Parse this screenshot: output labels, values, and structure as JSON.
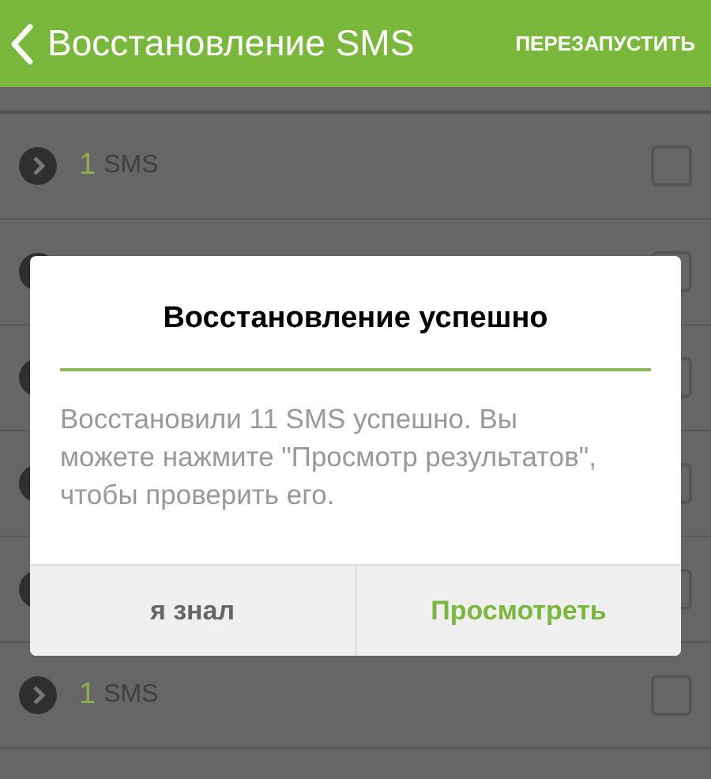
{
  "header": {
    "title": "Восстановление SMS",
    "action": "ПЕРЕЗАПУСТИТЬ"
  },
  "rows": [
    {
      "count": "1",
      "unit": "SMS",
      "checked": false
    },
    {
      "checked": false
    },
    {
      "checked": false
    },
    {
      "checked": false
    },
    {
      "checked": false
    },
    {
      "count": "1",
      "unit": "SMS",
      "checked": false
    }
  ],
  "dialog": {
    "title": "Восстановление успешно",
    "message": "Восстановили 11 SMS успешно. Вы можете нажмите \"Просмотр результатов\", чтобы проверить его.",
    "buttons": [
      {
        "label": "я знал",
        "primary": false
      },
      {
        "label": "Просмотреть",
        "primary": true
      }
    ]
  }
}
